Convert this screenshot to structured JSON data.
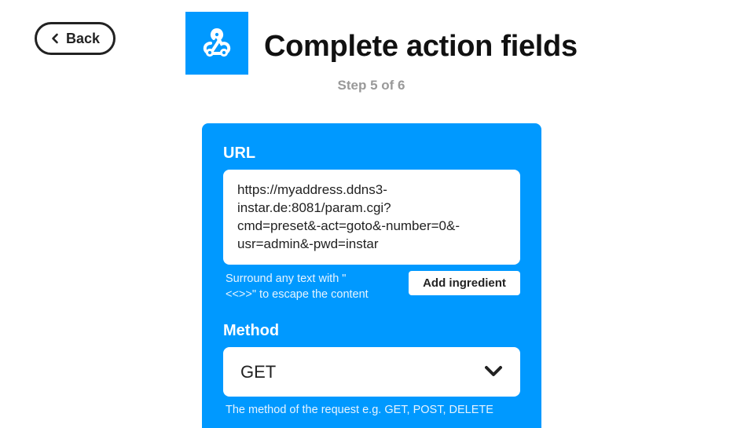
{
  "header": {
    "back_label": "Back",
    "title": "Complete action fields",
    "step": "Step 5 of 6",
    "service_icon": "webhooks-icon",
    "brand_color": "#0099ff"
  },
  "form": {
    "url": {
      "label": "URL",
      "value_lines": [
        "https://myaddress.ddns3-",
        "instar.de:8081/param.cgi?",
        "cmd=preset&-act=goto&-number=0&-",
        "usr=admin&-pwd=instar"
      ],
      "helper_lines": [
        "Surround any text with \"",
        "<<>>\" to escape the content"
      ],
      "add_ingredient_label": "Add ingredient"
    },
    "method": {
      "label": "Method",
      "selected": "GET",
      "helper": "The method of the request e.g. GET, POST, DELETE"
    }
  }
}
